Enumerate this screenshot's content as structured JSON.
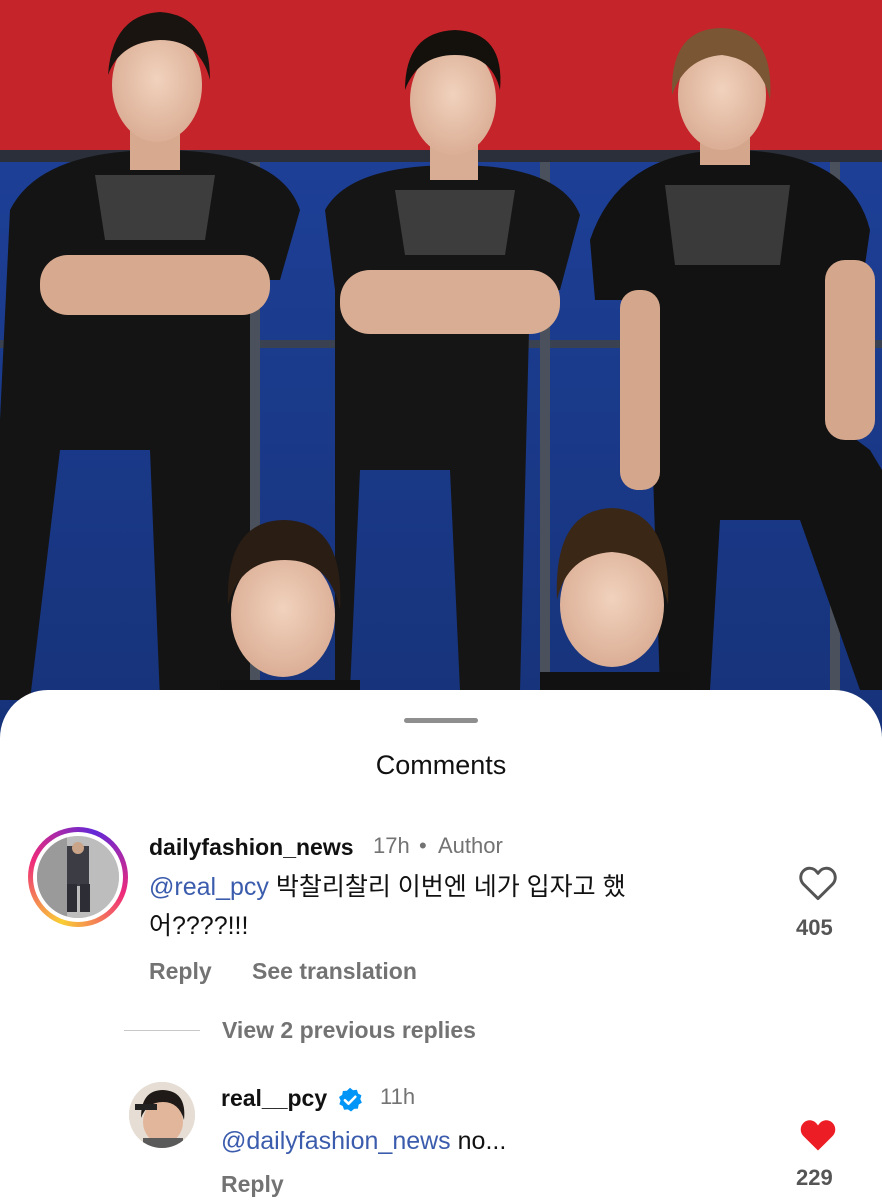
{
  "sheet": {
    "title": "Comments"
  },
  "comments": [
    {
      "username": "dailyfashion_news",
      "time": "17h",
      "separator": "•",
      "badge": "Author",
      "mention": "@real_pcy",
      "text_line1": " 박찰리찰리 이번엔 네가 입자고 했",
      "text_line2": "어????!!!",
      "reply_label": "Reply",
      "translation_label": "See translation",
      "like_icon": "heart-outline-icon",
      "likes": "405",
      "view_replies_label": "View 2 previous replies"
    },
    {
      "username": "real__pcy",
      "verified": true,
      "time": "11h",
      "mention": "@dailyfashion_news",
      "text": " no...",
      "reply_label": "Reply",
      "like_icon": "heart-filled-icon",
      "like_color": "#ed1d25",
      "likes": "229"
    }
  ],
  "colors": {
    "mention": "#3b5cad",
    "verified": "#0095f6",
    "muted_text": "#737373"
  }
}
